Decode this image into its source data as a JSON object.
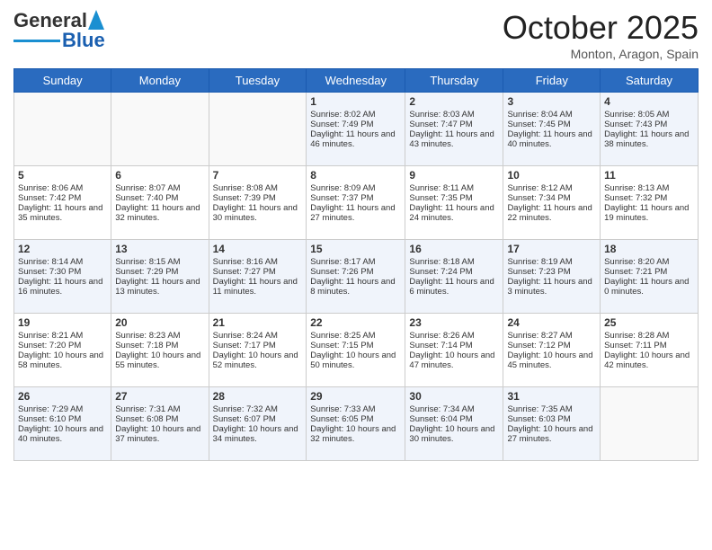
{
  "header": {
    "logo_general": "General",
    "logo_blue": "Blue",
    "month_title": "October 2025",
    "subtitle": "Monton, Aragon, Spain"
  },
  "weekdays": [
    "Sunday",
    "Monday",
    "Tuesday",
    "Wednesday",
    "Thursday",
    "Friday",
    "Saturday"
  ],
  "weeks": [
    [
      {
        "day": "",
        "info": ""
      },
      {
        "day": "",
        "info": ""
      },
      {
        "day": "",
        "info": ""
      },
      {
        "day": "1",
        "info": "Sunrise: 8:02 AM\nSunset: 7:49 PM\nDaylight: 11 hours and 46 minutes."
      },
      {
        "day": "2",
        "info": "Sunrise: 8:03 AM\nSunset: 7:47 PM\nDaylight: 11 hours and 43 minutes."
      },
      {
        "day": "3",
        "info": "Sunrise: 8:04 AM\nSunset: 7:45 PM\nDaylight: 11 hours and 40 minutes."
      },
      {
        "day": "4",
        "info": "Sunrise: 8:05 AM\nSunset: 7:43 PM\nDaylight: 11 hours and 38 minutes."
      }
    ],
    [
      {
        "day": "5",
        "info": "Sunrise: 8:06 AM\nSunset: 7:42 PM\nDaylight: 11 hours and 35 minutes."
      },
      {
        "day": "6",
        "info": "Sunrise: 8:07 AM\nSunset: 7:40 PM\nDaylight: 11 hours and 32 minutes."
      },
      {
        "day": "7",
        "info": "Sunrise: 8:08 AM\nSunset: 7:39 PM\nDaylight: 11 hours and 30 minutes."
      },
      {
        "day": "8",
        "info": "Sunrise: 8:09 AM\nSunset: 7:37 PM\nDaylight: 11 hours and 27 minutes."
      },
      {
        "day": "9",
        "info": "Sunrise: 8:11 AM\nSunset: 7:35 PM\nDaylight: 11 hours and 24 minutes."
      },
      {
        "day": "10",
        "info": "Sunrise: 8:12 AM\nSunset: 7:34 PM\nDaylight: 11 hours and 22 minutes."
      },
      {
        "day": "11",
        "info": "Sunrise: 8:13 AM\nSunset: 7:32 PM\nDaylight: 11 hours and 19 minutes."
      }
    ],
    [
      {
        "day": "12",
        "info": "Sunrise: 8:14 AM\nSunset: 7:30 PM\nDaylight: 11 hours and 16 minutes."
      },
      {
        "day": "13",
        "info": "Sunrise: 8:15 AM\nSunset: 7:29 PM\nDaylight: 11 hours and 13 minutes."
      },
      {
        "day": "14",
        "info": "Sunrise: 8:16 AM\nSunset: 7:27 PM\nDaylight: 11 hours and 11 minutes."
      },
      {
        "day": "15",
        "info": "Sunrise: 8:17 AM\nSunset: 7:26 PM\nDaylight: 11 hours and 8 minutes."
      },
      {
        "day": "16",
        "info": "Sunrise: 8:18 AM\nSunset: 7:24 PM\nDaylight: 11 hours and 6 minutes."
      },
      {
        "day": "17",
        "info": "Sunrise: 8:19 AM\nSunset: 7:23 PM\nDaylight: 11 hours and 3 minutes."
      },
      {
        "day": "18",
        "info": "Sunrise: 8:20 AM\nSunset: 7:21 PM\nDaylight: 11 hours and 0 minutes."
      }
    ],
    [
      {
        "day": "19",
        "info": "Sunrise: 8:21 AM\nSunset: 7:20 PM\nDaylight: 10 hours and 58 minutes."
      },
      {
        "day": "20",
        "info": "Sunrise: 8:23 AM\nSunset: 7:18 PM\nDaylight: 10 hours and 55 minutes."
      },
      {
        "day": "21",
        "info": "Sunrise: 8:24 AM\nSunset: 7:17 PM\nDaylight: 10 hours and 52 minutes."
      },
      {
        "day": "22",
        "info": "Sunrise: 8:25 AM\nSunset: 7:15 PM\nDaylight: 10 hours and 50 minutes."
      },
      {
        "day": "23",
        "info": "Sunrise: 8:26 AM\nSunset: 7:14 PM\nDaylight: 10 hours and 47 minutes."
      },
      {
        "day": "24",
        "info": "Sunrise: 8:27 AM\nSunset: 7:12 PM\nDaylight: 10 hours and 45 minutes."
      },
      {
        "day": "25",
        "info": "Sunrise: 8:28 AM\nSunset: 7:11 PM\nDaylight: 10 hours and 42 minutes."
      }
    ],
    [
      {
        "day": "26",
        "info": "Sunrise: 7:29 AM\nSunset: 6:10 PM\nDaylight: 10 hours and 40 minutes."
      },
      {
        "day": "27",
        "info": "Sunrise: 7:31 AM\nSunset: 6:08 PM\nDaylight: 10 hours and 37 minutes."
      },
      {
        "day": "28",
        "info": "Sunrise: 7:32 AM\nSunset: 6:07 PM\nDaylight: 10 hours and 34 minutes."
      },
      {
        "day": "29",
        "info": "Sunrise: 7:33 AM\nSunset: 6:05 PM\nDaylight: 10 hours and 32 minutes."
      },
      {
        "day": "30",
        "info": "Sunrise: 7:34 AM\nSunset: 6:04 PM\nDaylight: 10 hours and 30 minutes."
      },
      {
        "day": "31",
        "info": "Sunrise: 7:35 AM\nSunset: 6:03 PM\nDaylight: 10 hours and 27 minutes."
      },
      {
        "day": "",
        "info": ""
      }
    ]
  ]
}
